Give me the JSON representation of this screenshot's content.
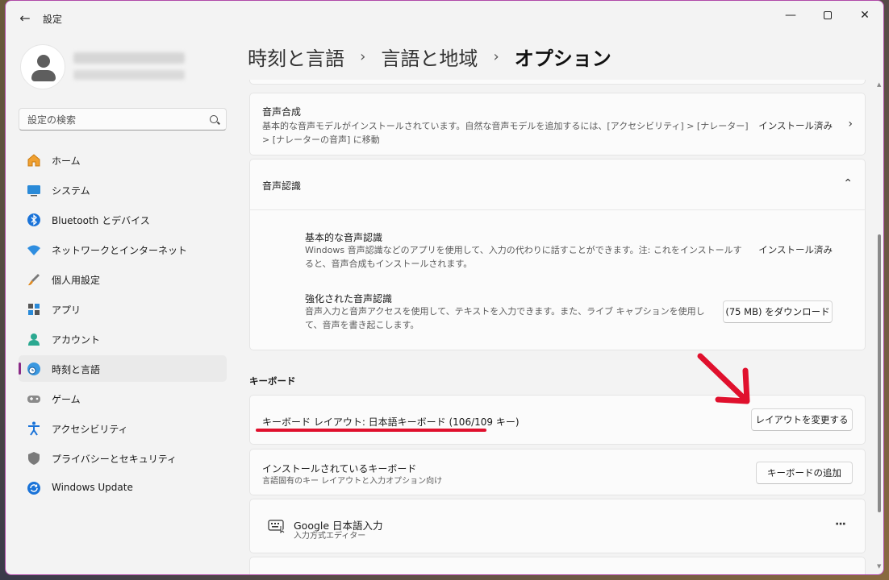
{
  "window": {
    "title": "設定"
  },
  "sidebar": {
    "search_placeholder": "設定の検索",
    "items": [
      {
        "label": "ホーム",
        "icon": "home-icon"
      },
      {
        "label": "システム",
        "icon": "system-icon"
      },
      {
        "label": "Bluetooth とデバイス",
        "icon": "bluetooth-icon"
      },
      {
        "label": "ネットワークとインターネット",
        "icon": "wifi-icon"
      },
      {
        "label": "個人用設定",
        "icon": "brush-icon"
      },
      {
        "label": "アプリ",
        "icon": "apps-icon"
      },
      {
        "label": "アカウント",
        "icon": "account-icon"
      },
      {
        "label": "時刻と言語",
        "icon": "time-language-icon",
        "active": true
      },
      {
        "label": "ゲーム",
        "icon": "gamepad-icon"
      },
      {
        "label": "アクセシビリティ",
        "icon": "accessibility-icon"
      },
      {
        "label": "プライバシーとセキュリティ",
        "icon": "shield-icon"
      },
      {
        "label": "Windows Update",
        "icon": "update-icon"
      }
    ]
  },
  "breadcrumb": {
    "level1": "時刻と言語",
    "level2": "言語と地域",
    "current": "オプション"
  },
  "speech_synthesis": {
    "title": "音声合成",
    "description": "基本的な音声モデルがインストールされています。自然な音声モデルを追加するには、[アクセシビリティ] > [ナレーター] > [ナレーターの音声] に移動",
    "status": "インストール済み"
  },
  "speech_recognition": {
    "title": "音声認識",
    "basic": {
      "title": "基本的な音声認識",
      "description": "Windows 音声認識などのアプリを使用して、入力の代わりに話すことができます。注: これをインストールすると、音声合成もインストールされます。",
      "status": "インストール済み"
    },
    "enhanced": {
      "title": "強化された音声認識",
      "description": "音声入力と音声アクセスを使用して、テキストを入力できます。また、ライブ キャプションを使用して、音声を書き起こします。",
      "button": "(75 MB) をダウンロード"
    }
  },
  "keyboard": {
    "section_title": "キーボード",
    "layout": {
      "title": "キーボード レイアウト: 日本語キーボード (106/109 キー)",
      "button": "レイアウトを変更する"
    },
    "installed": {
      "title": "インストールされているキーボード",
      "description": "言語固有のキー レイアウトと入力オプション向け",
      "button": "キーボードの追加"
    },
    "ime": {
      "title": "Google 日本語入力",
      "description": "入力方式エディター",
      "more": "···"
    }
  },
  "colors": {
    "accent": "#8a2a86",
    "annotation": "#e0102d"
  }
}
